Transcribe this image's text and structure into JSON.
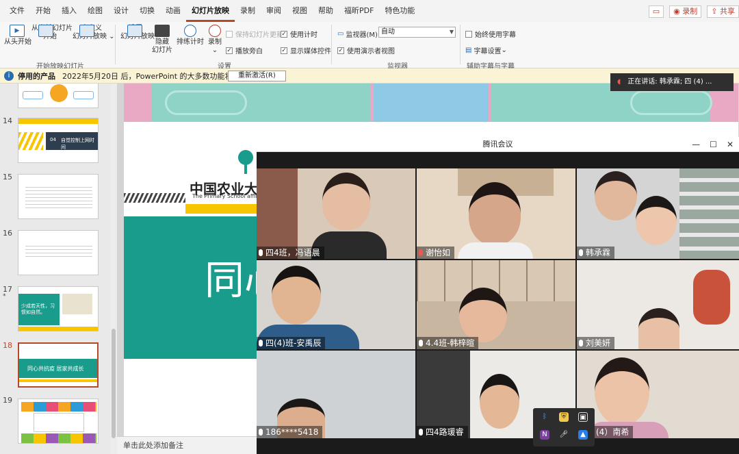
{
  "ribbon_tabs": [
    "文件",
    "开始",
    "插入",
    "绘图",
    "设计",
    "切换",
    "动画",
    "幻灯片放映",
    "录制",
    "审阅",
    "视图",
    "帮助",
    "福昕PDF",
    "特色功能"
  ],
  "active_tab": "幻灯片放映",
  "top_right": {
    "record": "录制",
    "share": "共享"
  },
  "ribbon": {
    "from_start": "从头开始",
    "from_current_1": "从当前幻灯片",
    "from_current_2": "开始",
    "custom_1": "自定义",
    "custom_2": "幻灯片放映",
    "setup_1": "设置",
    "setup_2": "幻灯片放映",
    "hide_1": "隐藏",
    "hide_2": "幻灯片",
    "rehearse": "排练计时",
    "record": "录制",
    "keep_updated": "保持幻灯片更新",
    "use_timing": "使用计时",
    "play_narration": "播放旁白",
    "show_media": "显示媒体控件",
    "monitor_label": "监视器(M):",
    "monitor_value": "自动",
    "presenter_view": "使用演示者视图",
    "always_subtitles": "始终使用字幕",
    "subtitle_settings": "字幕设置",
    "group_start": "开始放映幻灯片",
    "group_setup": "设置",
    "group_monitor": "监视器",
    "group_caption": "辅助字幕与字幕"
  },
  "notice": {
    "title": "停用的产品",
    "message": "2022年5月20日 后，PowerPoint 的大多数功能将被禁用。",
    "button": "重新激活(R)"
  },
  "speaking": "正在讲话: 韩承霖; 四 (4) ...",
  "thumbnails": [
    {
      "num": "14",
      "text": "自觉控制上网时间",
      "part": "04"
    },
    {
      "num": "15"
    },
    {
      "num": "16"
    },
    {
      "num": "17",
      "text": "少成若天性，习惯如自然。"
    },
    {
      "num": "18",
      "text": "同心共抗疫  居家共成长"
    },
    {
      "num": "19"
    }
  ],
  "slide": {
    "school_cn": "中国农业大学",
    "school_en": "The Primary School affiliated to C",
    "big_char": "同心"
  },
  "notes_placeholder": "单击此处添加备注",
  "meeting": {
    "title": "腾讯会议",
    "participants": [
      {
        "name": "四4班，冯语晨"
      },
      {
        "name": "谢怡如"
      },
      {
        "name": "韩承霖"
      },
      {
        "name": "四(4)班-安禹辰"
      },
      {
        "name": "4.4班-韩梓暄"
      },
      {
        "name": "刘美妍"
      },
      {
        "name": "186****5418"
      },
      {
        "name": "四4路瑗睿"
      },
      {
        "name": "(4）南希"
      }
    ]
  },
  "colors": {
    "accent": "#b7472a",
    "teal": "#1a9c8c",
    "yellow": "#f7c600",
    "notice_bg": "#fbf3d6"
  }
}
